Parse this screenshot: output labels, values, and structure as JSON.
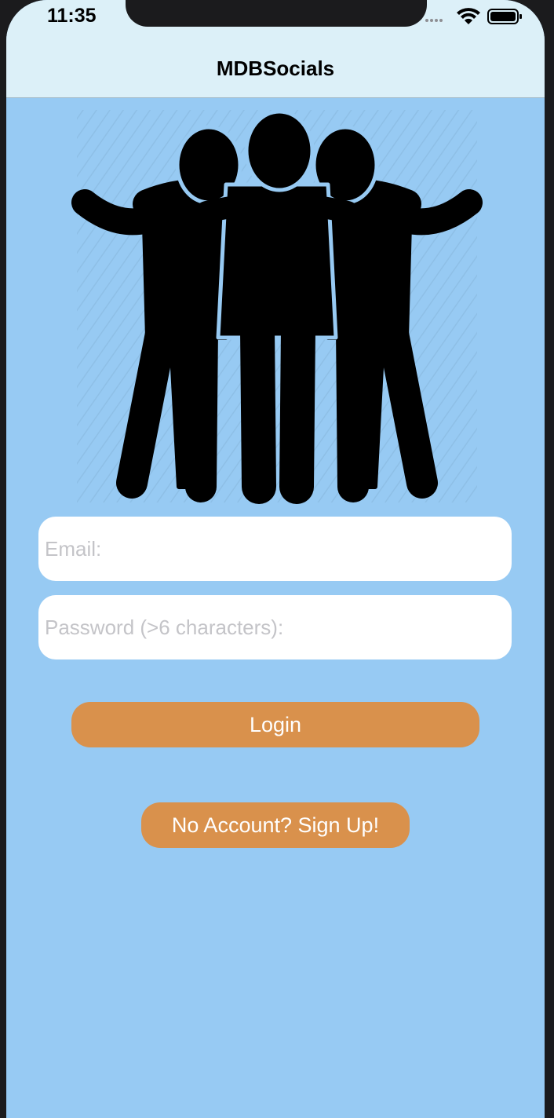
{
  "status_bar": {
    "time": "11:35",
    "icons": [
      "signal-icon",
      "wifi-icon",
      "battery-icon"
    ]
  },
  "nav": {
    "title": "MDBSocials"
  },
  "hero": {
    "image": "three-friends-icon"
  },
  "form": {
    "email_placeholder": "Email:",
    "password_placeholder": "Password (>6 characters):",
    "email_value": "",
    "password_value": ""
  },
  "buttons": {
    "login_label": "Login",
    "signup_label": "No Account? Sign Up!"
  },
  "colors": {
    "background": "#97caf3",
    "nav_bar": "#dcf0f8",
    "button": "#d9914c"
  }
}
